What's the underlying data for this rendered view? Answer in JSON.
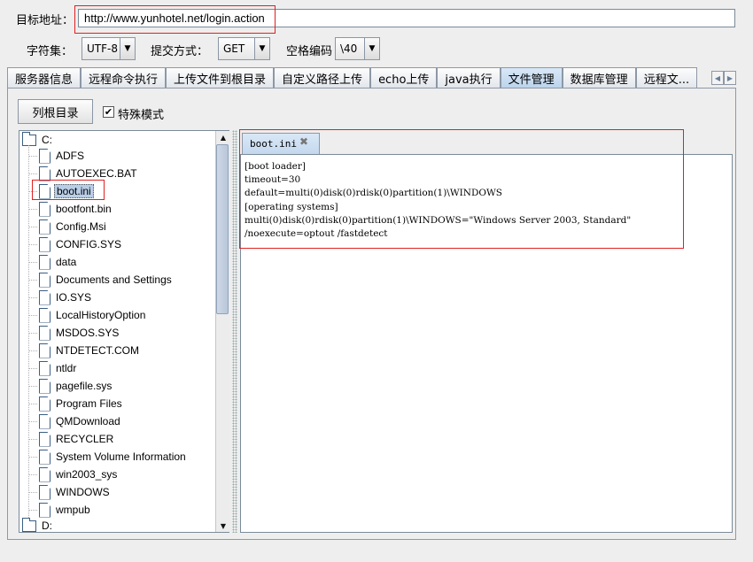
{
  "target": {
    "label": "目标地址：",
    "url": "http://www.yunhotel.net/login.action"
  },
  "options": {
    "charset_label": "字符集：",
    "charset_value": "UTF-8",
    "method_label": "提交方式：",
    "method_value": "GET",
    "space_label": "空格编码",
    "space_value": "\\40"
  },
  "tabs": [
    {
      "label": "服务器信息",
      "active": false
    },
    {
      "label": "远程命令执行",
      "active": false
    },
    {
      "label": "上传文件到根目录",
      "active": false
    },
    {
      "label": "自定义路径上传",
      "active": false
    },
    {
      "label": "echo上传",
      "active": false
    },
    {
      "label": "java执行",
      "active": false
    },
    {
      "label": "文件管理",
      "active": true
    },
    {
      "label": "数据库管理",
      "active": false
    },
    {
      "label": "远程文...",
      "active": false
    }
  ],
  "file_manager": {
    "list_root_label": "列根目录",
    "special_mode_label": "特殊模式",
    "special_mode_checked": true,
    "tree": {
      "root": "C:",
      "items": [
        "ADFS",
        "AUTOEXEC.BAT",
        "boot.ini",
        "bootfont.bin",
        "Config.Msi",
        "CONFIG.SYS",
        "data",
        "Documents and Settings",
        "IO.SYS",
        "LocalHistoryOption",
        "MSDOS.SYS",
        "NTDETECT.COM",
        "ntldr",
        "pagefile.sys",
        "Program Files",
        "QMDownload",
        "RECYCLER",
        "System Volume Information",
        "win2003_sys",
        "WINDOWS",
        "wmpub"
      ],
      "selected": "boot.ini",
      "next_root": "D:"
    },
    "editor": {
      "tab_label": "boot.ini",
      "content": "[boot loader]\ntimeout=30\ndefault=multi(0)disk(0)rdisk(0)partition(1)\\WINDOWS\n[operating systems]\nmulti(0)disk(0)rdisk(0)partition(1)\\WINDOWS=\"Windows Server 2003, Standard\"\n/noexecute=optout /fastdetect"
    }
  },
  "colors": {
    "highlight": "#e02020",
    "active_tab": "#c4d8ee",
    "selection": "#b9cde6"
  }
}
